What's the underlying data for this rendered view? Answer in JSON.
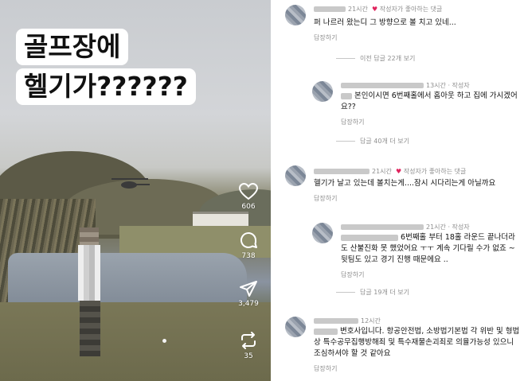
{
  "video": {
    "overlay_lines": [
      "골프장에",
      "헬기가??????"
    ],
    "actions": [
      {
        "icon": "heart-outline-icon",
        "count": "606"
      },
      {
        "icon": "comment-bubble-icon",
        "count": "738"
      },
      {
        "icon": "send-icon",
        "count": "3,479"
      },
      {
        "icon": "remix-icon",
        "count": "35"
      }
    ]
  },
  "comments": [
    {
      "time": "21시간",
      "badge": "작성자가 좋아하는 댓글",
      "text": "퍼 나르러 왔는디 그 방향으로 볼 치고 있네...",
      "reply": "답장하기",
      "more": "이전 답글 22개 보기"
    },
    {
      "time": "13시간 · 작성자",
      "text": "본인이시면 6번째홀에서 홈아웃 하고 집에 가시겠어요??",
      "reply": "답장하기",
      "more": "답글 40개 더 보기"
    },
    {
      "time": "21시간",
      "badge": "작성자가 좋아하는 댓글",
      "text": "헬기가 날고 있는데 볼치는게....잠시 시다리는게 아닐까요",
      "reply": "답장하기"
    },
    {
      "time": "21시간 · 작성자",
      "text": "6번째홀 부터 18홀 라운드 끝나더라도 산불진화 못 했었어요 ㅜㅜ 계속 기다릴 수가 없죠 ~ 뒷팀도 있고 경기 진행 때문에요 ..",
      "reply": "답장하기",
      "more": "답글 19개 더 보기"
    },
    {
      "time": "12시간",
      "text": "변호사입니다. 항공안전법, 소방법기본법 각 위반 및 형법상 특수공무집행방해죄 및 특수재물손괴죄로 의율가능성 있으니 조심하셔야 할 것 같아요",
      "reply": "답장하기"
    }
  ]
}
